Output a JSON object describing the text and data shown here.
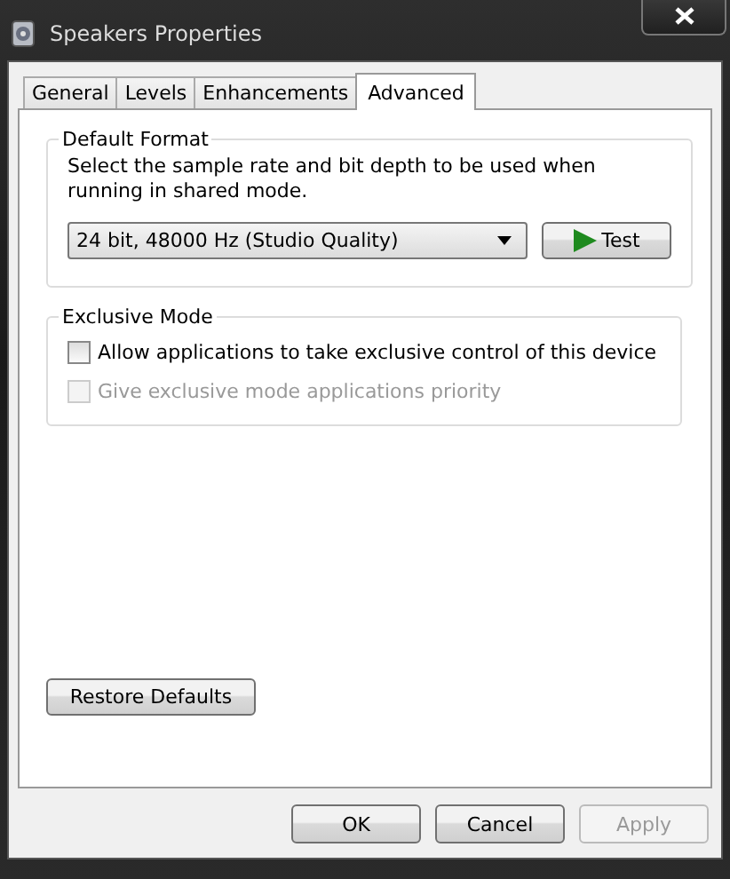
{
  "window": {
    "title": "Speakers Properties"
  },
  "tabs": [
    {
      "label": "General",
      "selected": false
    },
    {
      "label": "Levels",
      "selected": false
    },
    {
      "label": "Enhancements",
      "selected": false
    },
    {
      "label": "Advanced",
      "selected": true
    }
  ],
  "default_format": {
    "title": "Default Format",
    "description": "Select the sample rate and bit depth to be used when running in shared mode.",
    "dropdown": {
      "value": "24 bit, 48000 Hz (Studio Quality)"
    },
    "test_button": {
      "label": "Test"
    }
  },
  "exclusive_mode": {
    "title": "Exclusive Mode",
    "options": [
      {
        "label": "Allow applications to take exclusive control of this device",
        "checked": false,
        "disabled": false
      },
      {
        "label": "Give exclusive mode applications priority",
        "checked": false,
        "disabled": true
      }
    ]
  },
  "restore_button": {
    "label": "Restore Defaults"
  },
  "buttons": [
    {
      "label": "OK",
      "disabled": false
    },
    {
      "label": "Cancel",
      "disabled": false
    },
    {
      "label": "Apply",
      "disabled": true
    }
  ]
}
